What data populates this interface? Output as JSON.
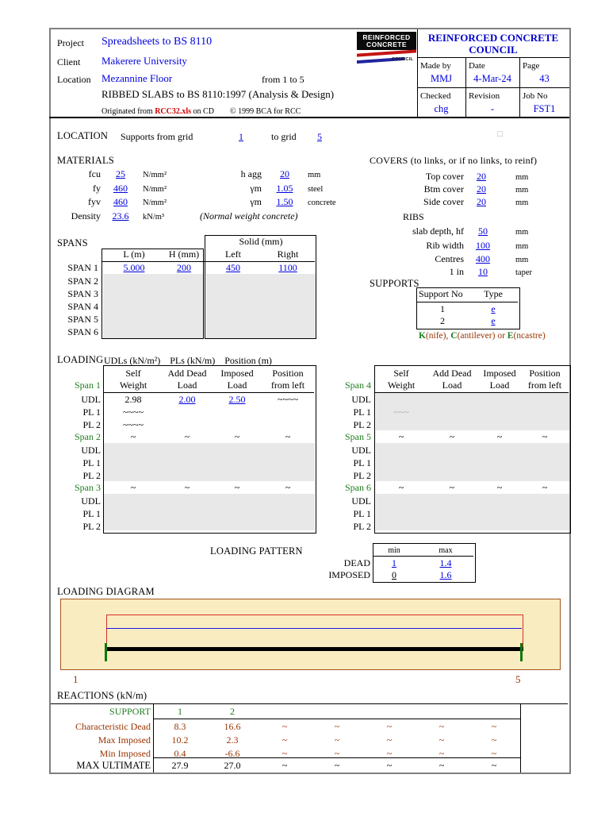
{
  "colors": {
    "link_blue": "#0000DD",
    "brand_blue": "#0000CC",
    "green": "#1E7D1E",
    "brown": "#993300",
    "logo_red": "#C41414",
    "logo_blue": "#22259E",
    "diagram_bg": "#F9ECC1",
    "diagram_border": "#A2541F",
    "beam_red": "#D93025",
    "beam_blue": "#1A1AE6",
    "support_tick_green": "#0B7A0B",
    "empty_cell_gray": "#E8E8E8"
  },
  "header": {
    "project_label": "Project",
    "project_value": "Spreadsheets to BS 8110",
    "client_label": "Client",
    "client_value": "Makerere University",
    "location_label": "Location",
    "location_value": "Mezannine Floor",
    "range_note": "from 1 to 5",
    "sheet_title": "RIBBED SLABS to BS 8110:1997 (Analysis & Design)",
    "originated_prefix": "Originated from ",
    "originated_file": "RCC32.xls",
    "originated_suffix": " on CD",
    "copyright": "© 1999 BCA for RCC",
    "logo": {
      "line1": "REINFORCED",
      "line2": "CONCRETE",
      "council": "COUNCIL"
    },
    "council_name": "REINFORCED CONCRETE COUNCIL",
    "made_by": {
      "label": "Made by",
      "value": "MMJ"
    },
    "date": {
      "label": "Date",
      "value": "4-Mar-24"
    },
    "page": {
      "label": "Page",
      "value": "43"
    },
    "checked": {
      "label": "Checked",
      "value": "chg"
    },
    "revision": {
      "label": "Revision",
      "value": "-"
    },
    "job_no": {
      "label": "Job No",
      "value": "FST1"
    }
  },
  "location": {
    "title": "LOCATION",
    "text": "Supports from grid",
    "grid_from": "1",
    "to_grid_text": "to grid",
    "grid_to": "5",
    "marker": "□"
  },
  "materials": {
    "title": "MATERIALS",
    "left": [
      {
        "label": "fcu",
        "value": "25",
        "unit": "N/mm²"
      },
      {
        "label": "fy",
        "value": "460",
        "unit": "N/mm²"
      },
      {
        "label": "fyv",
        "value": "460",
        "unit": "N/mm²"
      },
      {
        "label": "Density",
        "value": "23.6",
        "unit": "kN/m³"
      }
    ],
    "right": [
      {
        "label": "h agg",
        "value": "20",
        "unit": "mm"
      },
      {
        "label": "γm",
        "value": "1.05",
        "unit": "steel"
      },
      {
        "label": "γm",
        "value": "1.50",
        "unit": "concrete"
      }
    ],
    "note": "(Normal weight concrete)"
  },
  "covers": {
    "title": "COVERS (to links, or if no links, to reinf)",
    "rows": [
      {
        "label": "Top cover",
        "value": "20",
        "unit": "mm"
      },
      {
        "label": "Btm cover",
        "value": "20",
        "unit": "mm"
      },
      {
        "label": "Side cover",
        "value": "20",
        "unit": "mm"
      }
    ]
  },
  "ribs": {
    "title": "RIBS",
    "rows": [
      {
        "label": "slab depth, hf",
        "value": "50",
        "unit": "mm"
      },
      {
        "label": "Rib width",
        "value": "100",
        "unit": "mm"
      },
      {
        "label": "Centres",
        "value": "400",
        "unit": "mm"
      },
      {
        "label": "1 in",
        "value": "10",
        "unit": "taper"
      }
    ]
  },
  "spans": {
    "title": "SPANS",
    "solid_header": "Solid (mm)",
    "columns": [
      "L (m)",
      "H (mm)",
      "Left",
      "Right"
    ],
    "row_labels": [
      "SPAN 1",
      "SPAN 2",
      "SPAN 3",
      "SPAN 4",
      "SPAN 5",
      "SPAN 6"
    ],
    "span1": [
      "5.000",
      "200",
      "450",
      "1100"
    ]
  },
  "supports": {
    "title": "SUPPORTS",
    "col_no": "Support No",
    "col_type": "Type",
    "rows": [
      {
        "no": "1",
        "type": "e"
      },
      {
        "no": "2",
        "type": "e"
      }
    ],
    "note": {
      "k": "K",
      "k_rest": "(nife), ",
      "c": "C",
      "c_rest": "(antilever) or ",
      "e": "E",
      "e_rest": "(ncastre)"
    }
  },
  "loading": {
    "title": "LOADING",
    "units_line": "UDLs (kN/m²)    PLs (kN/m)    Position (m)",
    "col_line1": [
      "Self",
      "Add Dead",
      "Imposed",
      "Position"
    ],
    "col_line2": [
      "Weight",
      "Load",
      "Load",
      "from left"
    ],
    "row_labels": [
      "UDL",
      "PL 1",
      "PL 2"
    ],
    "tilde": "~",
    "span1": {
      "label": "Span 1",
      "udl": [
        "2.98",
        "2.00",
        "2.50",
        "~~~~"
      ],
      "pl1": "~~~~",
      "pl2": "~~~~"
    },
    "span2": {
      "label": "Span 2"
    },
    "span3": {
      "label": "Span 3"
    },
    "span4": {
      "label": "Span 4",
      "pl1": "~~~"
    },
    "span5": {
      "label": "Span 5"
    },
    "span6": {
      "label": "Span 6"
    }
  },
  "pattern": {
    "title": "LOADING PATTERN",
    "col_min": "min",
    "col_max": "max",
    "dead": {
      "label": "DEAD",
      "min": "1",
      "max": "1.4"
    },
    "imposed": {
      "label": "IMPOSED",
      "min": "0",
      "max": "1.6"
    }
  },
  "diagram": {
    "title": "LOADING DIAGRAM",
    "left_support": "1",
    "right_support": "5"
  },
  "reactions": {
    "title": "REACTIONS (kN/m)",
    "support_label": "SUPPORT",
    "support_values": [
      "1",
      "2"
    ],
    "rows": [
      {
        "label": "Characteristic Dead",
        "values": [
          "8.3",
          "16.6",
          "~",
          "~",
          "~",
          "~",
          "~"
        ]
      },
      {
        "label": "Max Imposed",
        "values": [
          "10.2",
          "2.3",
          "~",
          "~",
          "~",
          "~",
          "~"
        ]
      },
      {
        "label": "Min Imposed",
        "values": [
          "0.4",
          "-6.6",
          "~",
          "~",
          "~",
          "~",
          "~"
        ]
      },
      {
        "label": "MAX ULTIMATE",
        "values": [
          "27.9",
          "27.0",
          "~",
          "~",
          "~",
          "~",
          "~"
        ]
      }
    ]
  }
}
